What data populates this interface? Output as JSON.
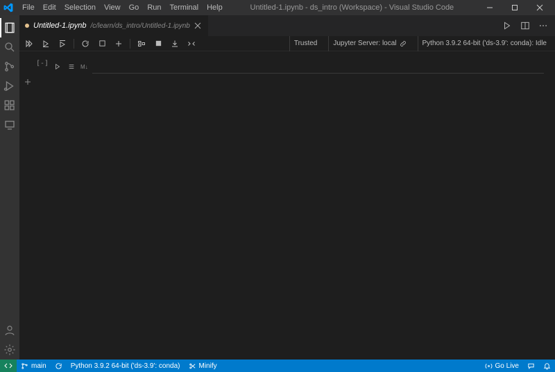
{
  "titlebar": {
    "menus": [
      "File",
      "Edit",
      "Selection",
      "View",
      "Go",
      "Run",
      "Terminal",
      "Help"
    ],
    "title": "Untitled-1.ipynb - ds_intro (Workspace) - Visual Studio Code"
  },
  "tab": {
    "label": "Untitled-1.ipynb",
    "sublabel": "/c/learn/ds_intro/Untitled-1.ipynb",
    "dirty": true
  },
  "notebook_toolbar_right": {
    "trusted": "Trusted",
    "server": "Jupyter Server: local",
    "kernel": "Python 3.9.2 64-bit ('ds-3.9': conda): Idle"
  },
  "cell": {
    "prompt": "[-]",
    "lang_hint": "M↓"
  },
  "statusbar": {
    "branch": "main",
    "interpreter": "Python 3.9.2 64-bit ('ds-3.9': conda)",
    "minify": "Minify",
    "golive": "Go Live"
  }
}
